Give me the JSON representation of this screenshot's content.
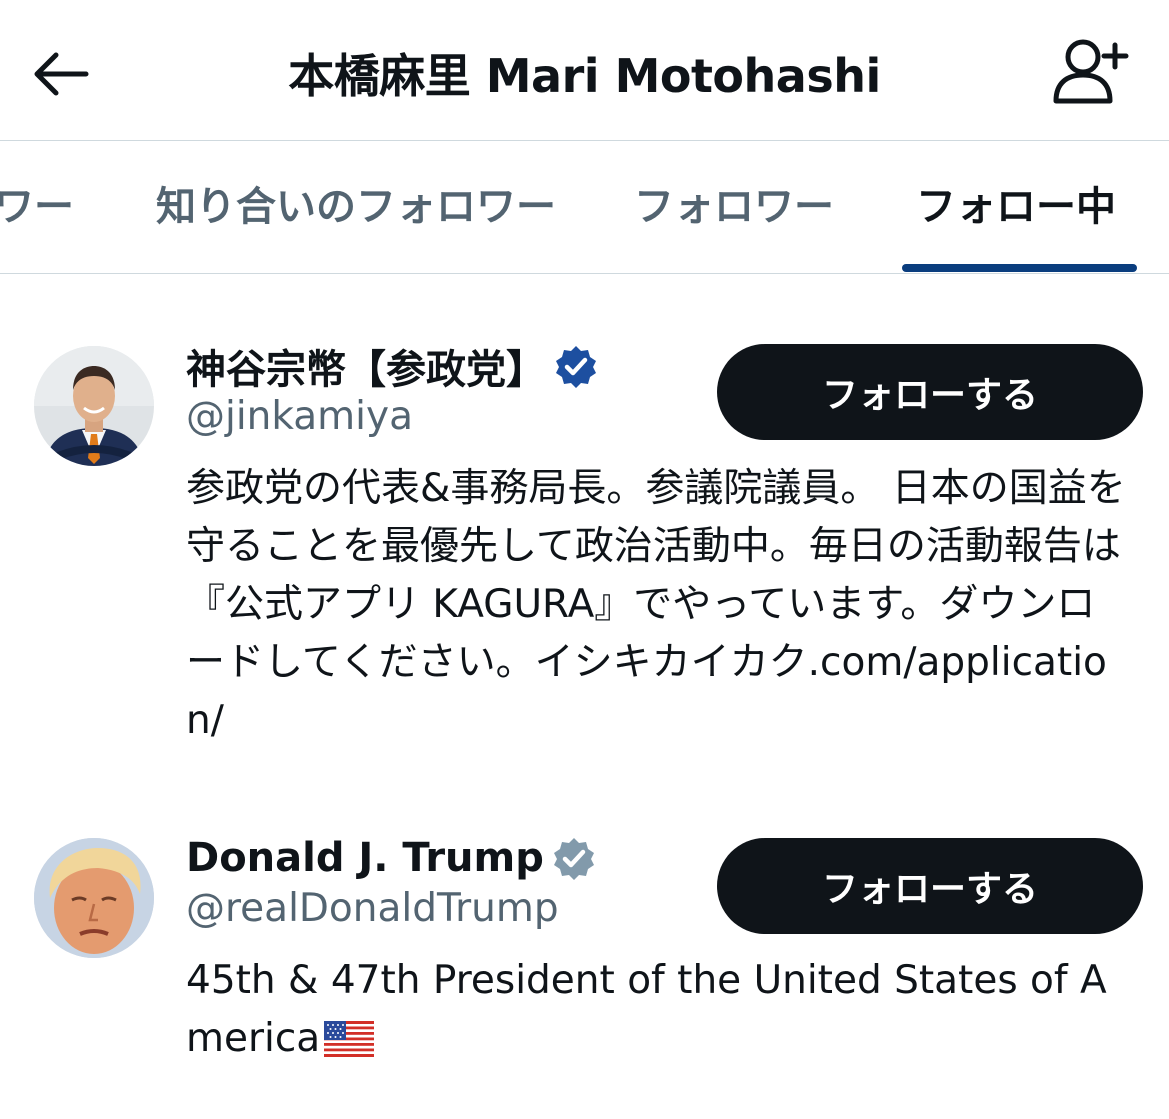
{
  "header": {
    "title": "本橋麻里 Mari Motohashi",
    "back_icon": "arrow-left-icon",
    "add_user_icon": "person-add-icon"
  },
  "tabs": [
    {
      "label": "ワー",
      "active": false
    },
    {
      "label": "知り合いのフォロワー",
      "active": false
    },
    {
      "label": "フォロワー",
      "active": false
    },
    {
      "label": "フォロー中",
      "active": true
    }
  ],
  "colors": {
    "accent_indicator": "#0a3d7e",
    "button_bg": "#0f1419",
    "muted_text": "#536471",
    "verified_blue": "#1d4fa0",
    "verified_grey": "#829aab"
  },
  "users": [
    {
      "display_name": "神谷宗幣【参政党】",
      "handle": "@jinkamiya",
      "verified_badge": "blue",
      "follow_label": "フォローする",
      "bio": "参政党の代表&事務局長。参議院議員。 日本の国益を守ることを最優先して政治活動中。毎日の活動報告は『公式アプリ KAGURA』でやっています。ダウンロードしてください。イシキカイカク.com/application/"
    },
    {
      "display_name": "Donald J. Trump",
      "handle": "@realDonaldTrump",
      "verified_badge": "grey",
      "follow_label": "フォローする",
      "bio": "45th & 47th President of the United States of America",
      "bio_emoji": "🇺🇸"
    }
  ]
}
